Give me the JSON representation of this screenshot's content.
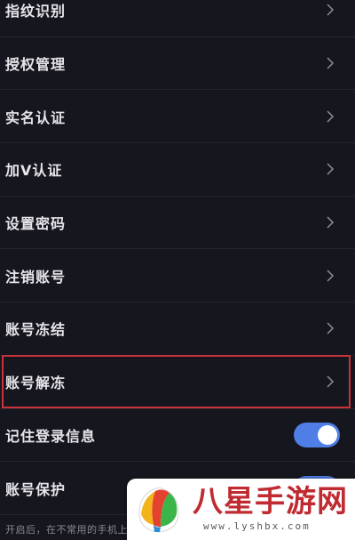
{
  "settings": {
    "items": [
      {
        "label": "指纹识别"
      },
      {
        "label": "授权管理"
      },
      {
        "label": "实名认证"
      },
      {
        "label": "加V认证"
      },
      {
        "label": "设置密码"
      },
      {
        "label": "注销账号"
      },
      {
        "label": "账号冻结"
      },
      {
        "label": "账号解冻"
      }
    ],
    "toggles": [
      {
        "label": "记住登录信息",
        "on": true
      },
      {
        "label": "账号保护",
        "on": true
      }
    ],
    "footer_note": "开启后，在不常用的手机上"
  },
  "colors": {
    "background": "#16161e",
    "toggle_on": "#4f7ee6",
    "highlight_border": "#c8323a",
    "watermark_red": "#c02a31"
  },
  "watermark": {
    "title": "八星手游网",
    "site": "www.lyshbx.com"
  }
}
